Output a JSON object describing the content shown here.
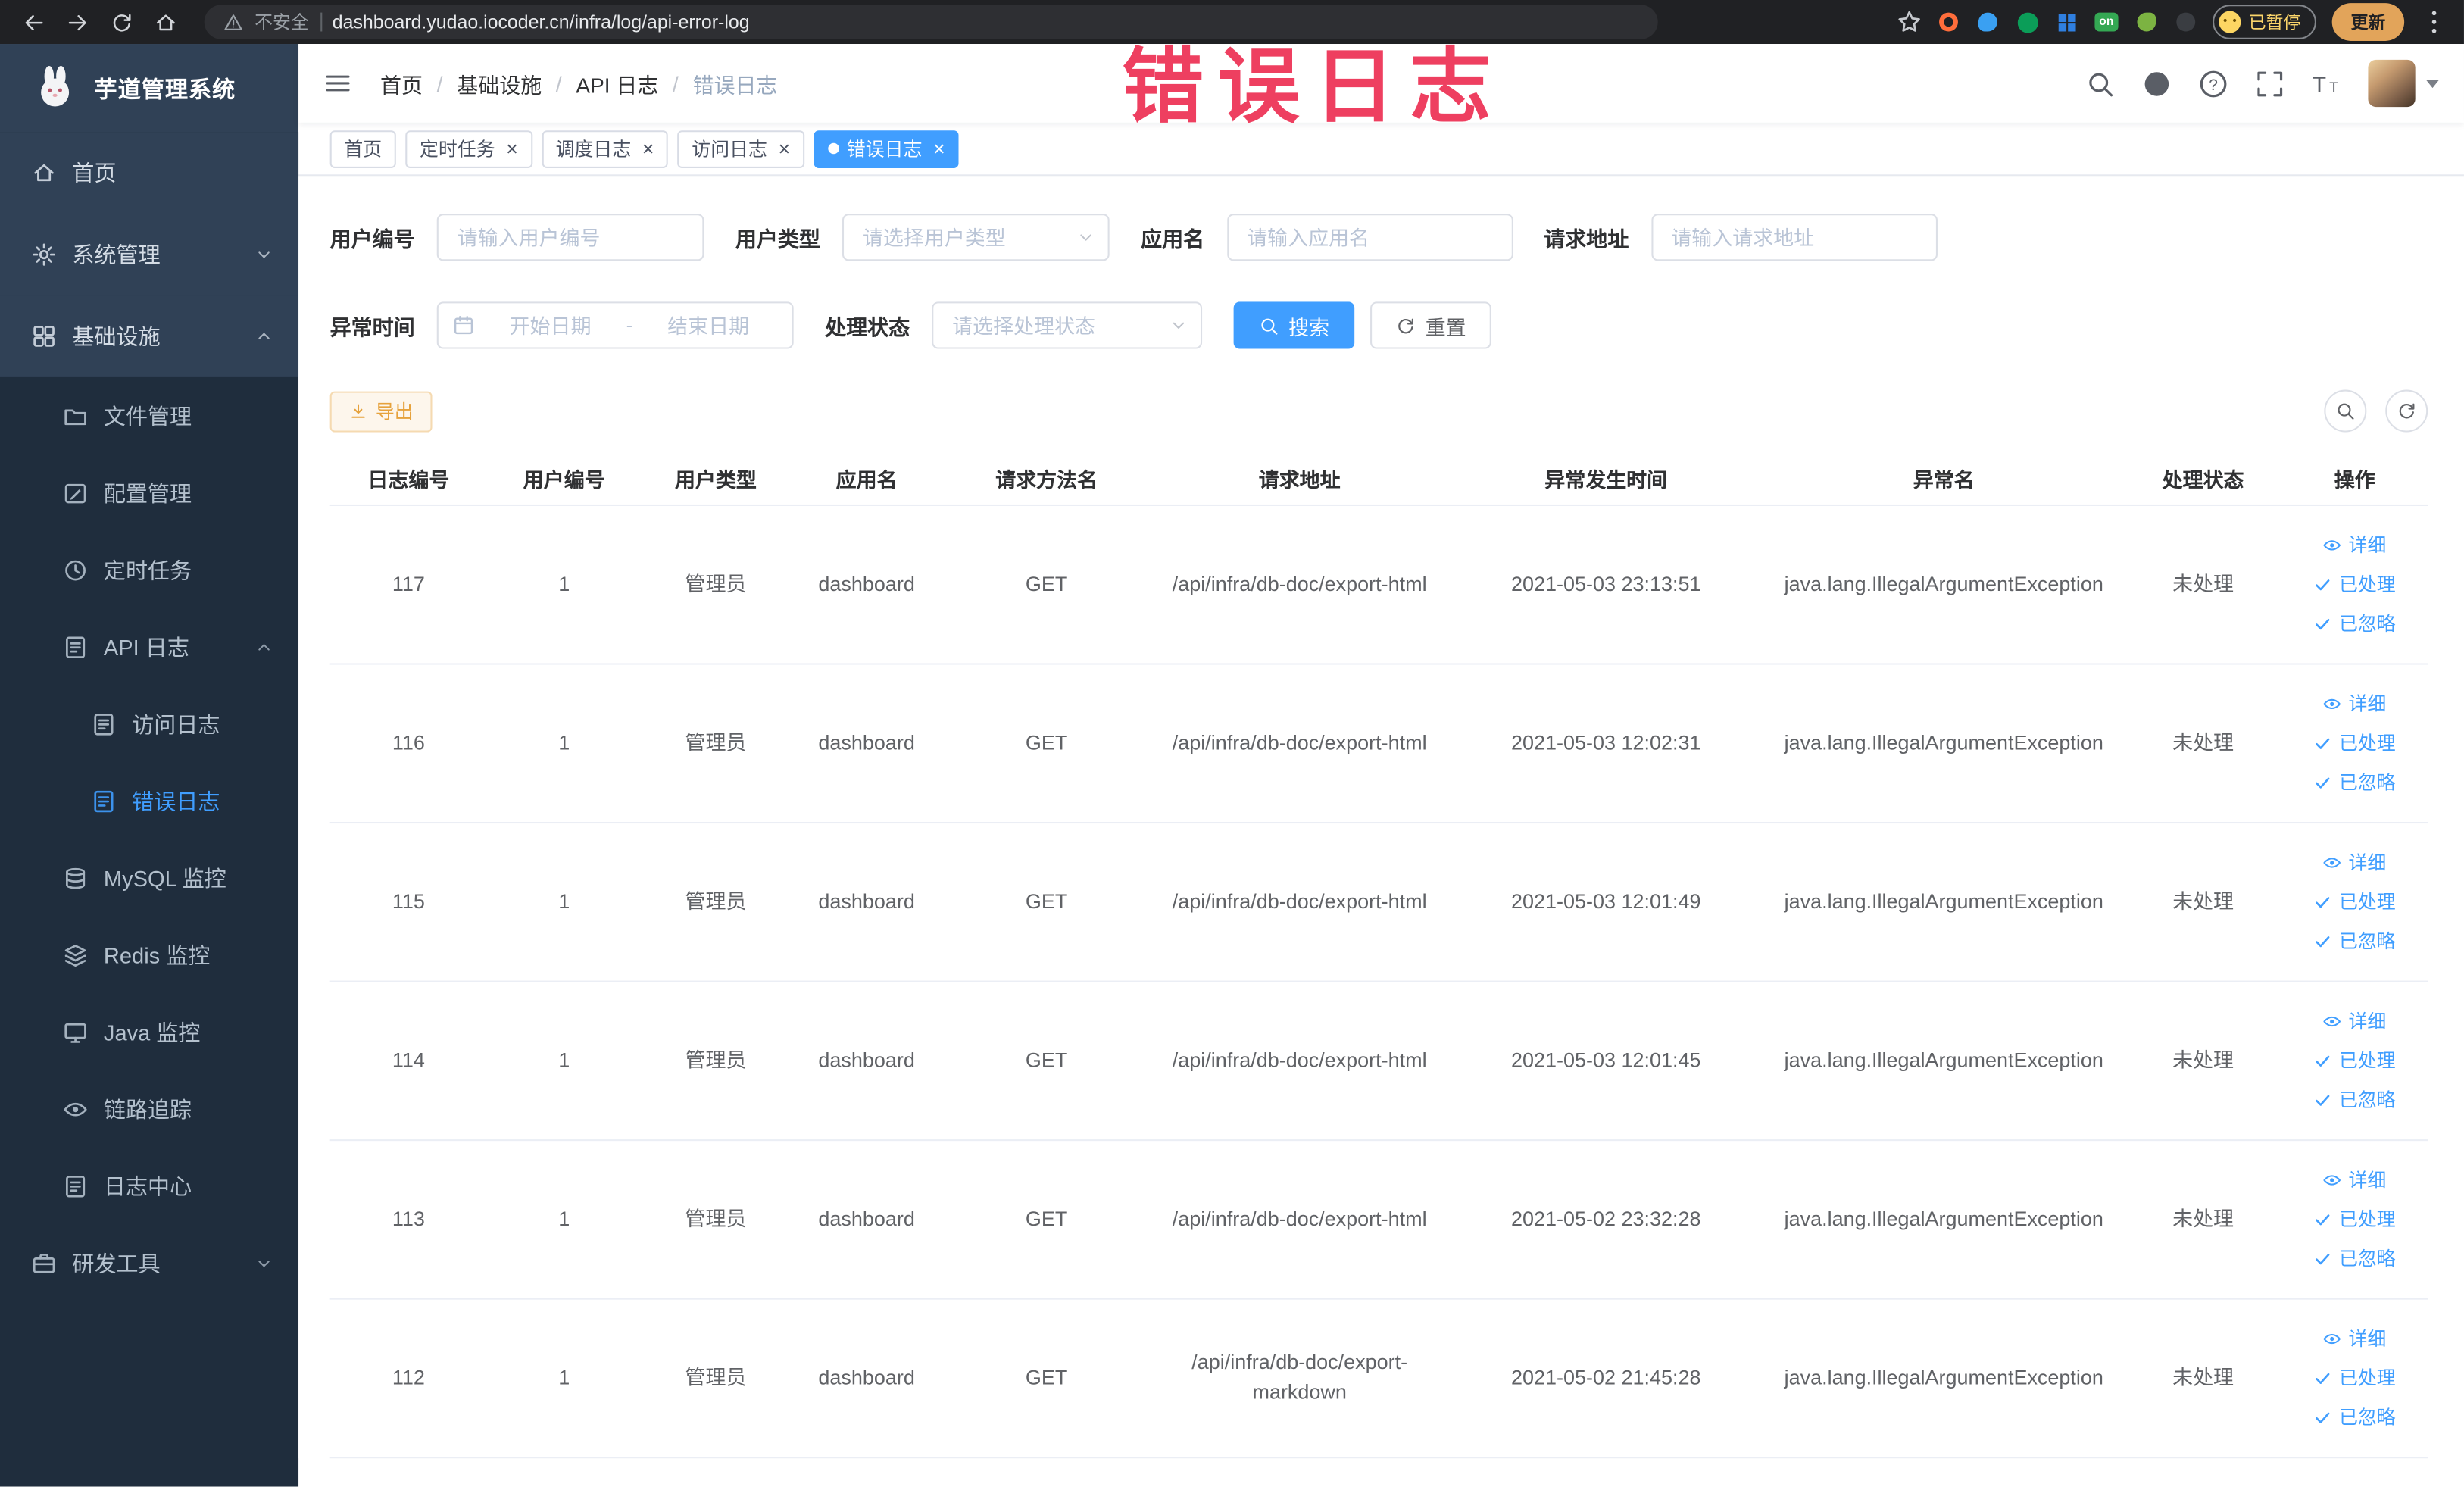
{
  "theme": {
    "primary": "#409EFF",
    "warning": "#E6A23C",
    "watermark_color": "#EE3F60",
    "sidebar_bg": "#304156",
    "sidebar_sub_bg": "#1F2D3D"
  },
  "browser": {
    "security_label": "不安全",
    "url": "dashboard.yudao.iocoder.cn/infra/log/api-error-log",
    "extension_badge": "on",
    "paused_badge": "已暂停",
    "update_button": "更新"
  },
  "watermark": "错误日志",
  "sidebar": {
    "logo_title": "芋道管理系统",
    "items": [
      {
        "label": "首页",
        "icon": "home-icon",
        "level": 1
      },
      {
        "label": "系统管理",
        "icon": "gear-icon",
        "level": 1,
        "arrow": "down"
      },
      {
        "label": "基础设施",
        "icon": "grid-icon",
        "level": 1,
        "arrow": "up"
      },
      {
        "label": "文件管理",
        "icon": "folder-icon",
        "level": 2,
        "sub": true
      },
      {
        "label": "配置管理",
        "icon": "edit-icon",
        "level": 2,
        "sub": true
      },
      {
        "label": "定时任务",
        "icon": "clock-icon",
        "level": 2,
        "sub": true
      },
      {
        "label": "API 日志",
        "icon": "doc-edit-icon",
        "level": 2,
        "sub": true,
        "arrow": "up"
      },
      {
        "label": "访问日志",
        "icon": "doc-edit-icon",
        "level": 3,
        "sub": true
      },
      {
        "label": "错误日志",
        "icon": "doc-edit-icon",
        "level": 3,
        "sub": true,
        "active": true
      },
      {
        "label": "MySQL 监控",
        "icon": "database-icon",
        "level": 2,
        "sub": true
      },
      {
        "label": "Redis 监控",
        "icon": "layers-icon",
        "level": 2,
        "sub": true
      },
      {
        "label": "Java 监控",
        "icon": "monitor-icon",
        "level": 2,
        "sub": true
      },
      {
        "label": "链路追踪",
        "icon": "eye-icon",
        "level": 2,
        "sub": true
      },
      {
        "label": "日志中心",
        "icon": "doc-icon",
        "level": 2,
        "sub": true
      },
      {
        "label": "研发工具",
        "icon": "toolbox-icon",
        "level": 1,
        "sub": true,
        "arrow": "down"
      }
    ]
  },
  "navbar": {
    "breadcrumb": [
      {
        "label": "首页"
      },
      {
        "label": "基础设施"
      },
      {
        "label": "API 日志"
      },
      {
        "label": "错误日志",
        "current": true
      }
    ]
  },
  "tabs": [
    {
      "label": "首页",
      "closable": false,
      "active": false
    },
    {
      "label": "定时任务",
      "closable": true,
      "active": false
    },
    {
      "label": "调度日志",
      "closable": true,
      "active": false
    },
    {
      "label": "访问日志",
      "closable": true,
      "active": false
    },
    {
      "label": "错误日志",
      "closable": true,
      "active": true
    }
  ],
  "filters": {
    "user_id": {
      "label": "用户编号",
      "placeholder": "请输入用户编号",
      "value": ""
    },
    "user_type": {
      "label": "用户类型",
      "placeholder": "请选择用户类型",
      "value": ""
    },
    "app_name": {
      "label": "应用名",
      "placeholder": "请输入应用名",
      "value": ""
    },
    "request_url": {
      "label": "请求地址",
      "placeholder": "请输入请求地址",
      "value": ""
    },
    "exception_time": {
      "label": "异常时间",
      "start_placeholder": "开始日期",
      "separator": "-",
      "end_placeholder": "结束日期"
    },
    "process_status": {
      "label": "处理状态",
      "placeholder": "请选择处理状态",
      "value": ""
    },
    "search_button": "搜索",
    "reset_button": "重置"
  },
  "toolbar": {
    "export_button": "导出"
  },
  "table": {
    "columns": [
      {
        "label": "日志编号",
        "key": "id"
      },
      {
        "label": "用户编号",
        "key": "user_id"
      },
      {
        "label": "用户类型",
        "key": "user_type"
      },
      {
        "label": "应用名",
        "key": "app_name"
      },
      {
        "label": "请求方法名",
        "key": "method"
      },
      {
        "label": "请求地址",
        "key": "url"
      },
      {
        "label": "异常发生时间",
        "key": "time"
      },
      {
        "label": "异常名",
        "key": "exception"
      },
      {
        "label": "处理状态",
        "key": "status"
      },
      {
        "label": "操作",
        "key": "actions"
      }
    ],
    "row_actions": [
      {
        "label": "详细",
        "icon": "eye-icon"
      },
      {
        "label": "已处理",
        "icon": "check-icon"
      },
      {
        "label": "已忽略",
        "icon": "check-icon"
      }
    ],
    "rows": [
      {
        "id": "117",
        "user_id": "1",
        "user_type": "管理员",
        "app_name": "dashboard",
        "method": "GET",
        "url": "/api/infra/db-doc/export-html",
        "time": "2021-05-03 23:13:51",
        "exception": "java.lang.IllegalArgumentException",
        "status": "未处理"
      },
      {
        "id": "116",
        "user_id": "1",
        "user_type": "管理员",
        "app_name": "dashboard",
        "method": "GET",
        "url": "/api/infra/db-doc/export-html",
        "time": "2021-05-03 12:02:31",
        "exception": "java.lang.IllegalArgumentException",
        "status": "未处理"
      },
      {
        "id": "115",
        "user_id": "1",
        "user_type": "管理员",
        "app_name": "dashboard",
        "method": "GET",
        "url": "/api/infra/db-doc/export-html",
        "time": "2021-05-03 12:01:49",
        "exception": "java.lang.IllegalArgumentException",
        "status": "未处理"
      },
      {
        "id": "114",
        "user_id": "1",
        "user_type": "管理员",
        "app_name": "dashboard",
        "method": "GET",
        "url": "/api/infra/db-doc/export-html",
        "time": "2021-05-03 12:01:45",
        "exception": "java.lang.IllegalArgumentException",
        "status": "未处理"
      },
      {
        "id": "113",
        "user_id": "1",
        "user_type": "管理员",
        "app_name": "dashboard",
        "method": "GET",
        "url": "/api/infra/db-doc/export-html",
        "time": "2021-05-02 23:32:28",
        "exception": "java.lang.IllegalArgumentException",
        "status": "未处理"
      },
      {
        "id": "112",
        "user_id": "1",
        "user_type": "管理员",
        "app_name": "dashboard",
        "method": "GET",
        "url": "/api/infra/db-doc/export-markdown",
        "time": "2021-05-02 21:45:28",
        "exception": "java.lang.IllegalArgumentException",
        "status": "未处理"
      }
    ]
  }
}
